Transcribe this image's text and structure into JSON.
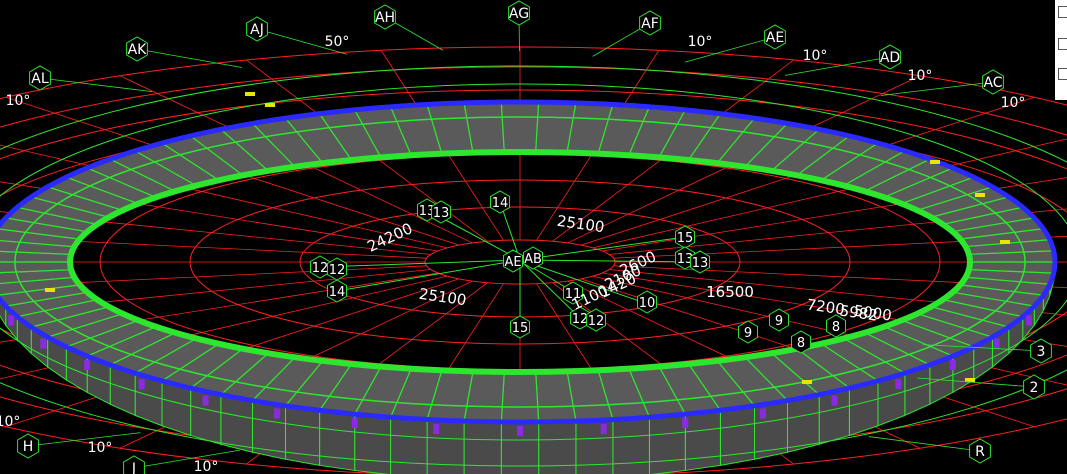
{
  "grid_labels": {
    "outer": [
      "AL",
      "AK",
      "AJ",
      "AH",
      "AG",
      "AF",
      "AE",
      "AD",
      "AC",
      "H",
      "J",
      "R",
      "2",
      "3"
    ],
    "inner": [
      "AE",
      "AB",
      "14",
      "13",
      "13",
      "12",
      "12",
      "14",
      "15",
      "13",
      "13",
      "15",
      "11",
      "12",
      "12",
      "10",
      "9",
      "9",
      "8",
      "8"
    ]
  },
  "dimensions": [
    "24200",
    "25100",
    "25100",
    "16500",
    "7200",
    "5000",
    "5982",
    "1100",
    "1420",
    "2600",
    "2100"
  ],
  "angles": [
    "10°",
    "50°",
    "10°",
    "10°",
    "10°",
    "10°",
    "10°",
    "10°",
    "10°"
  ],
  "colors": {
    "background": "#000000",
    "grid_line": "#ff2020",
    "structure_green": "#2ee62e",
    "ring_blue": "#2a2aff",
    "panel_gray": "#5a5a5a",
    "member_purple": "#8a2be2",
    "highlight_yellow": "#e6e600"
  },
  "side_panel": {
    "icons": [
      "checkbox-icon",
      "cube-icon",
      "layers-icon"
    ]
  }
}
